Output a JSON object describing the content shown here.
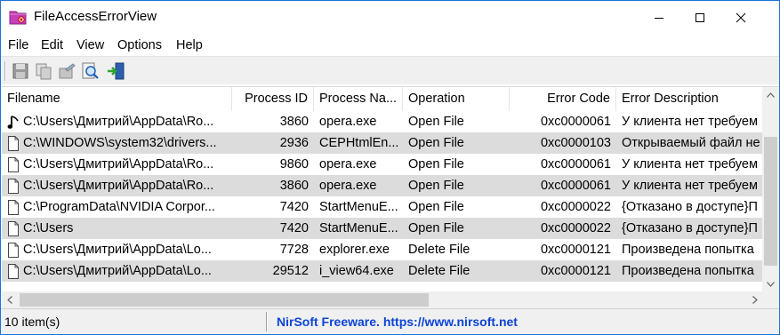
{
  "window": {
    "title": "FileAccessErrorView"
  },
  "menu": [
    "File",
    "Edit",
    "View",
    "Options",
    "Help"
  ],
  "toolbar": [
    "save-icon",
    "copy-icon",
    "properties-icon",
    "find-icon",
    "exit-icon"
  ],
  "columns": [
    "Filename",
    "Process ID",
    "Process Na...",
    "Operation",
    "Error Code",
    "Error Description"
  ],
  "rows": [
    {
      "filename": "C:\\Users\\Дмитрий\\AppData\\Ro...",
      "pid": "3860",
      "process": "opera.exe",
      "operation": "Open File",
      "error_code": "0xc0000061",
      "description": "У клиента нет требуем",
      "icon": "music-note-icon"
    },
    {
      "filename": "C:\\WINDOWS\\system32\\drivers...",
      "pid": "2936",
      "process": "CEPHtmlEn...",
      "operation": "Open File",
      "error_code": "0xc0000103",
      "description": "Открываемый файл не",
      "icon": "file-icon"
    },
    {
      "filename": "C:\\Users\\Дмитрий\\AppData\\Ro...",
      "pid": "9860",
      "process": "opera.exe",
      "operation": "Open File",
      "error_code": "0xc0000061",
      "description": "У клиента нет требуем",
      "icon": "file-icon"
    },
    {
      "filename": "C:\\Users\\Дмитрий\\AppData\\Ro...",
      "pid": "3860",
      "process": "opera.exe",
      "operation": "Open File",
      "error_code": "0xc0000061",
      "description": "У клиента нет требуем",
      "icon": "file-icon"
    },
    {
      "filename": "C:\\ProgramData\\NVIDIA Corpor...",
      "pid": "7420",
      "process": "StartMenuE...",
      "operation": "Open File",
      "error_code": "0xc0000022",
      "description": "{Отказано в доступе}П",
      "icon": "file-icon"
    },
    {
      "filename": "C:\\Users",
      "pid": "7420",
      "process": "StartMenuE...",
      "operation": "Open File",
      "error_code": "0xc0000022",
      "description": "{Отказано в доступе}П",
      "icon": "file-icon"
    },
    {
      "filename": "C:\\Users\\Дмитрий\\AppData\\Lo...",
      "pid": "7728",
      "process": "explorer.exe",
      "operation": "Delete File",
      "error_code": "0xc0000121",
      "description": "Произведена попытка",
      "icon": "file-icon"
    },
    {
      "filename": "C:\\Users\\Дмитрий\\AppData\\Lo...",
      "pid": "29512",
      "process": "i_view64.exe",
      "operation": "Delete File",
      "error_code": "0xc0000121",
      "description": "Произведена попытка",
      "icon": "file-icon"
    }
  ],
  "status": {
    "count": "10 item(s)",
    "link": "NirSoft Freeware. https://www.nirsoft.net"
  }
}
